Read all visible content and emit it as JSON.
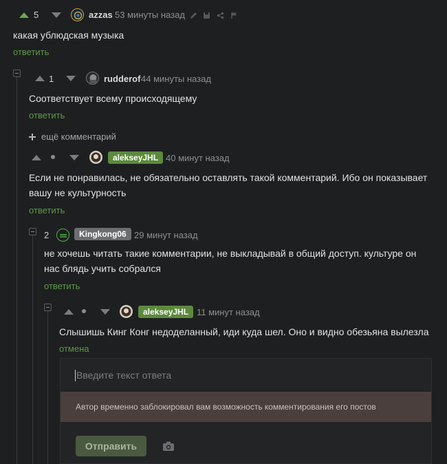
{
  "comments": [
    {
      "score": "5",
      "author": "azzas",
      "time": "53 минуты назад",
      "text": "какая ублюдская музыка",
      "reply_label": "ответить"
    },
    {
      "score": "1",
      "author": "rudderof",
      "time": "44 минуты назад",
      "text": "Соответствует всему происходящему",
      "reply_label": "ответить"
    },
    {
      "author": "alekseyJHL",
      "time": "40 минут назад",
      "text": "Если не понравилась, не обязательно оставлять такой комментарий. Ибо он показывает вашу не культурность",
      "reply_label": "ответить"
    },
    {
      "score": "2",
      "author": "Kingkong06",
      "time": "29 минут назад",
      "text": "не хочешь читать такие комментарии, не выкладывай в общий доступ. культуре он нас блядь учить собрался",
      "reply_label": "ответить"
    },
    {
      "author": "alekseyJHL",
      "time": "11 минут назад",
      "text": "Слышишь Кинг Конг недоделанный, иди куда шел. Оно и видно обезьяна вылезла",
      "cancel_label": "отмена"
    }
  ],
  "more_comments": "ещё комментарий",
  "reply_form": {
    "placeholder": "Введите текст ответа",
    "blocked_notice": "Автор временно заблокировал вам возможность комментирования его постов",
    "submit_label": "Отправить"
  },
  "colors": {
    "accent_green": "#6aa84f",
    "op_badge": "#5c8a3c",
    "author_badge_gray": "#6b6d70",
    "link_green": "#5c9a45"
  },
  "icons": [
    "thumb-up-icon",
    "thumb-down-icon",
    "pencil-icon",
    "save-icon",
    "share-icon",
    "flag-icon",
    "plus-icon",
    "camera-icon"
  ]
}
